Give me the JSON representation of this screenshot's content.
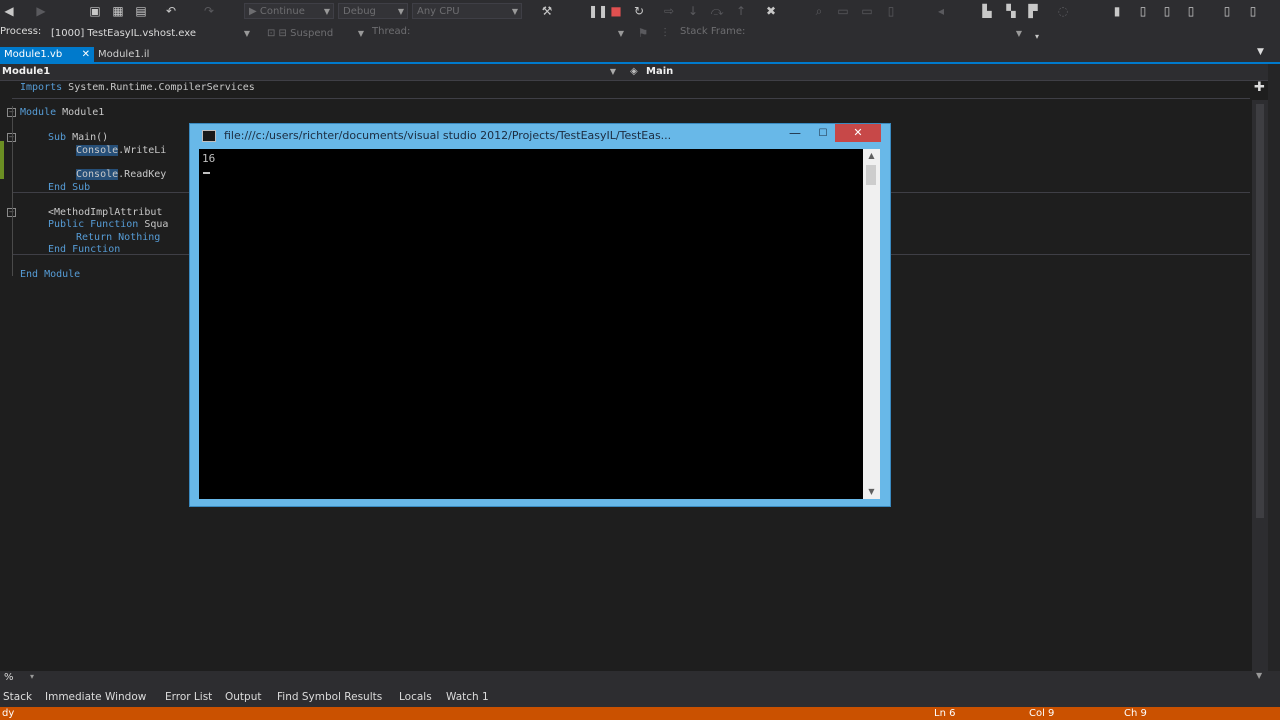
{
  "toolbar": {
    "continue_label": "Continue",
    "config": "Debug",
    "platform": "Any CPU"
  },
  "debugbar": {
    "process_label": "Process:",
    "process_value": "[1000] TestEasyIL.vshost.exe",
    "suspend_label": "Suspend",
    "thread_label": "Thread:",
    "stack_frame_label": "Stack Frame:"
  },
  "tabs": [
    {
      "label": "Module1.vb",
      "close": "✕"
    },
    {
      "label": "Module1.il"
    }
  ],
  "navbar": {
    "left": "Module1",
    "right": "Main"
  },
  "code": [
    {
      "kw": "Imports",
      "rest": " System.Runtime.CompilerServices"
    },
    {
      "kw": "Module",
      "rest": " Module1"
    },
    {
      "kw": "Sub",
      "rest": " Main()"
    },
    {
      "hl": "Console",
      "rest": ".WriteLi"
    },
    {
      "hl": "Console",
      "rest": ".ReadKey"
    },
    {
      "kw": "End Sub",
      "rest": ""
    },
    {
      "kw": "",
      "rest": "<MethodImplAttribut"
    },
    {
      "kw": "Public Function",
      "rest": " Squa"
    },
    {
      "kw": "Return Nothing",
      "rest": ""
    },
    {
      "kw": "End Function",
      "rest": ""
    },
    {
      "kw": "End Module",
      "rest": ""
    }
  ],
  "console": {
    "title": "file:///c:/users/richter/documents/visual studio 2012/Projects/TestEasyIL/TestEas...",
    "output": "16",
    "min": "—",
    "max": "☐",
    "close": "✕"
  },
  "editor": {
    "zoom": "%"
  },
  "bottom_tabs": [
    "Stack",
    "Immediate Window",
    "Error List",
    "Output",
    "Find Symbol Results",
    "Locals",
    "Watch 1"
  ],
  "status": {
    "left": "dy",
    "ln": "Ln 6",
    "col": "Col 9",
    "ch": "Ch 9"
  },
  "colors": {
    "accent": "#007acc",
    "status_debug": "#ca5100",
    "keyword": "#569cd6",
    "console_frame": "#68b8e8",
    "close_button": "#c74848"
  }
}
